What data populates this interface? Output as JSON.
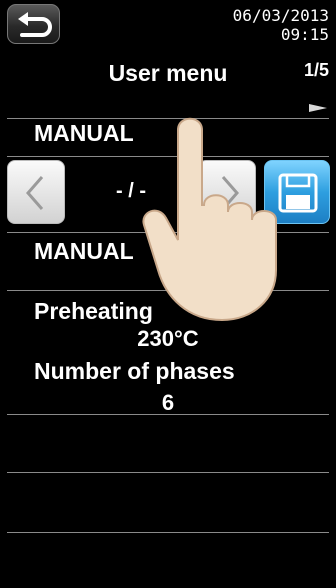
{
  "status_bar": {
    "date": "06/03/2013",
    "time": "09:15"
  },
  "header": {
    "title": "User menu",
    "page_indicator": "1/5"
  },
  "mode_row": {
    "label": "MANUAL"
  },
  "selector": {
    "value": "- / -"
  },
  "program_row": {
    "label": "MANUAL"
  },
  "preheating": {
    "label": "Preheating",
    "value": "230°C"
  },
  "phases": {
    "label": "Number of phases",
    "value": "6"
  },
  "colors": {
    "background": "#000000",
    "save_accent": "#2e9fe0"
  },
  "icons": {
    "back": "back-arrow-icon",
    "prev": "chevron-left-icon",
    "next": "chevron-right-icon",
    "save": "floppy-disk-icon",
    "page_next": "triangle-right-icon",
    "hand": "pointing-hand-icon"
  }
}
